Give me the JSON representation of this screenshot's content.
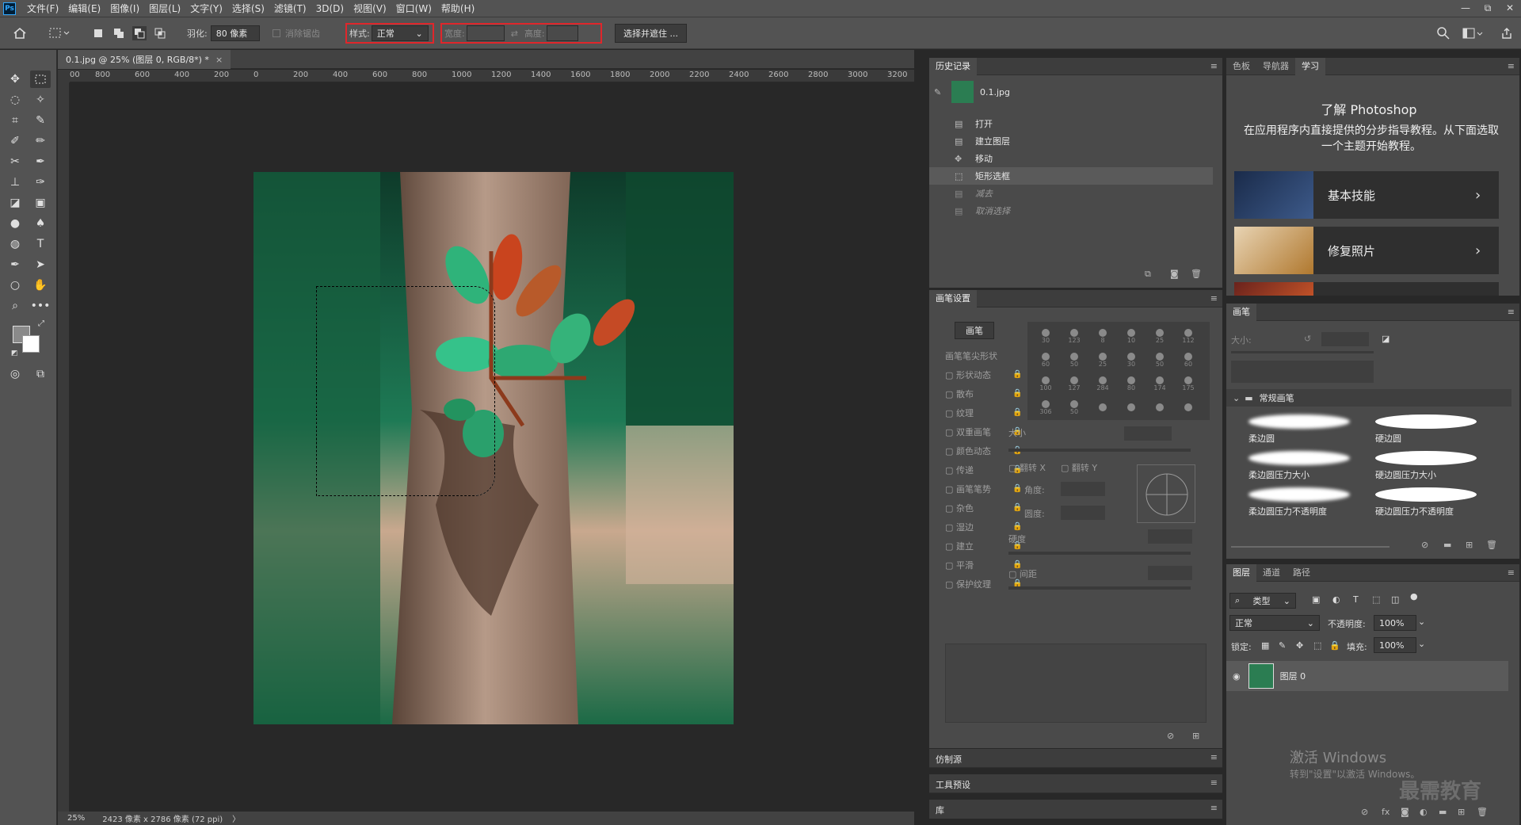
{
  "app": {
    "logo": "Ps"
  },
  "menu": [
    "文件(F)",
    "编辑(E)",
    "图像(I)",
    "图层(L)",
    "文字(Y)",
    "选择(S)",
    "滤镜(T)",
    "3D(D)",
    "视图(V)",
    "窗口(W)",
    "帮助(H)"
  ],
  "window_controls": {
    "minimize": "—",
    "restore": "⧉",
    "close": "✕"
  },
  "options": {
    "feather_label": "羽化:",
    "feather_value": "80 像素",
    "antialias_label": "消除锯齿",
    "style_label": "样式:",
    "style_value": "正常",
    "width_label": "宽度:",
    "height_label": "高度:",
    "select_mask_button": "选择并遮住 ..."
  },
  "document": {
    "tab_title": "0.1.jpg @ 25% (图层 0, RGB/8*) *",
    "tab_close": "×",
    "ruler_labels": [
      "00",
      "800",
      "600",
      "400",
      "200",
      "0",
      "200",
      "400",
      "600",
      "800",
      "1000",
      "1200",
      "1400",
      "1600",
      "1800",
      "2000",
      "2200",
      "2400",
      "2600",
      "2800",
      "3000",
      "3200"
    ],
    "zoom": "25%",
    "size_info": "2423 像素 x 2786 像素 (72 ppi)",
    "status_arrow": "〉"
  },
  "history": {
    "tab": "历史记录",
    "snapshot": "0.1.jpg",
    "items": [
      {
        "label": "打开",
        "state": "normal"
      },
      {
        "label": "建立图层",
        "state": "normal"
      },
      {
        "label": "移动",
        "state": "normal"
      },
      {
        "label": "矩形选框",
        "state": "selected"
      },
      {
        "label": "减去",
        "state": "dim"
      },
      {
        "label": "取消选择",
        "state": "dim"
      }
    ]
  },
  "brush_settings": {
    "tab": "画笔设置",
    "brushes_button": "画笔",
    "tip_shape": "画笔笔尖形状",
    "options": [
      "形状动态",
      "散布",
      "纹理",
      "双重画笔",
      "颜色动态",
      "传递",
      "画笔笔势",
      "杂色",
      "湿边",
      "建立",
      "平滑",
      "保护纹理"
    ],
    "tip_sizes": [
      "30",
      "123",
      "8",
      "10",
      "25",
      "112",
      "60",
      "50",
      "25",
      "30",
      "50",
      "60",
      "100",
      "127",
      "284",
      "80",
      "174",
      "175",
      "306",
      "50",
      "",
      "",
      "",
      ""
    ],
    "size_label": "大小",
    "flip_x": "翻转 X",
    "flip_y": "翻转 Y",
    "angle_label": "角度:",
    "roundness_label": "圆度:",
    "hardness_label": "硬度",
    "spacing_label": "间距"
  },
  "collapsed_panels": [
    "仿制源",
    "工具预设",
    "库"
  ],
  "learn": {
    "tabs": [
      "色板",
      "导航器",
      "学习"
    ],
    "active_tab": "学习",
    "title": "了解 Photoshop",
    "description": "在应用程序内直接提供的分步指导教程。从下面选取一个主题开始教程。",
    "cards": [
      "基本技能",
      "修复照片",
      ""
    ]
  },
  "brushes_panel": {
    "tab": "画笔",
    "size_label": "大小:",
    "group": "常规画笔",
    "items": [
      "柔边圆",
      "硬边圆",
      "柔边圆压力大小",
      "硬边圆压力大小",
      "柔边圆压力不透明度",
      "硬边圆压力不透明度"
    ]
  },
  "layers": {
    "tabs": [
      "图层",
      "通道",
      "路径"
    ],
    "active_tab": "图层",
    "filter_type": "类型",
    "blend_mode": "正常",
    "opacity_label": "不透明度:",
    "opacity_value": "100%",
    "lock_label": "锁定:",
    "fill_label": "填充:",
    "fill_value": "100%",
    "layer_name": "图层 0"
  },
  "watermark": {
    "activate_title": "激活 Windows",
    "activate_sub": "转到\"设置\"以激活 Windows。",
    "brand": "最需教育"
  },
  "colors": {
    "accent_red": "#e0262b",
    "selection": "#5a5a5a"
  }
}
